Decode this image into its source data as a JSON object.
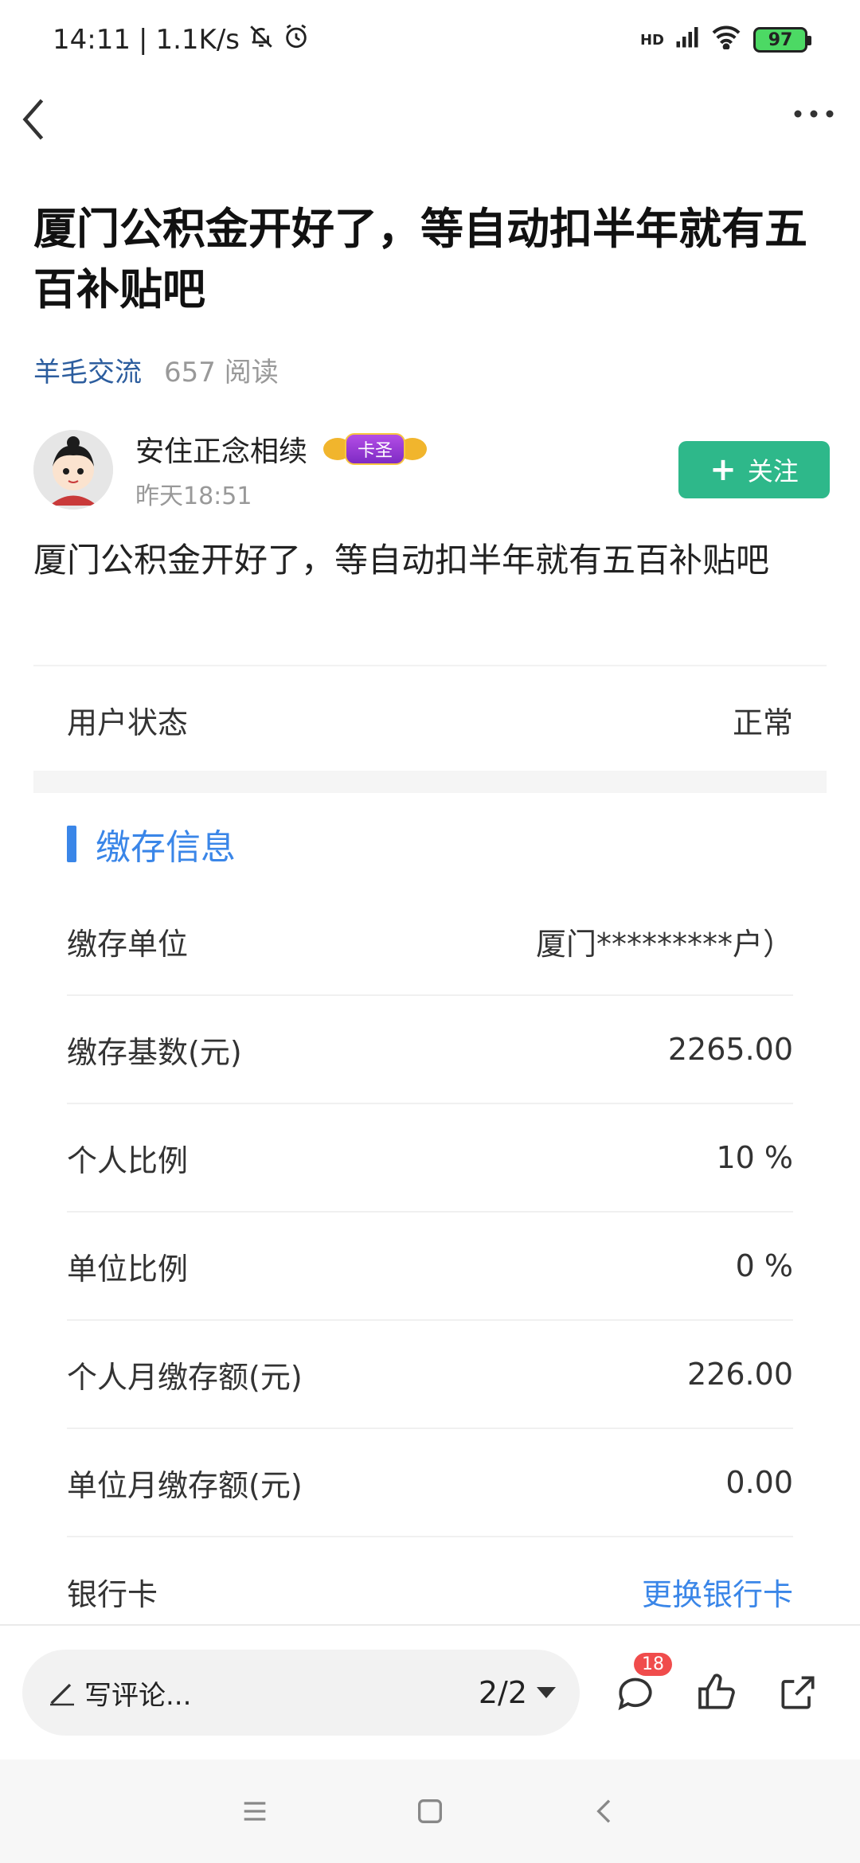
{
  "status": {
    "time": "14:11",
    "speed": "1.1K/s",
    "battery": "97",
    "network": "HD"
  },
  "article": {
    "title": "厦门公积金开好了，等自动扣半年就有五百补贴吧",
    "category": "羊毛交流",
    "reads": "657 阅读",
    "body": "厦门公积金开好了，等自动扣半年就有五百补贴吧"
  },
  "author": {
    "name": "安住正念相续",
    "badge": "卡圣",
    "time": "昨天18:51",
    "follow_label": "关注"
  },
  "status_row": {
    "label": "用户状态",
    "value": "正常"
  },
  "section": {
    "title": "缴存信息"
  },
  "rows": [
    {
      "label": "缴存单位",
      "value": "厦门*********户）"
    },
    {
      "label": "缴存基数(元)",
      "value": "2265.00"
    },
    {
      "label": "个人比例",
      "value": "10 %"
    },
    {
      "label": "单位比例",
      "value": "0 %"
    },
    {
      "label": "个人月缴存额(元)",
      "value": "226.00"
    },
    {
      "label": "单位月缴存额(元)",
      "value": "0.00"
    },
    {
      "label": "银行卡",
      "value": "更换银行卡"
    }
  ],
  "bottom": {
    "comment_placeholder": "写评论...",
    "pages": "2/2",
    "comment_count": "18"
  },
  "colors": {
    "accent": "#3a86e8",
    "follow": "#2eb88a",
    "badge_red": "#f04c4c"
  }
}
